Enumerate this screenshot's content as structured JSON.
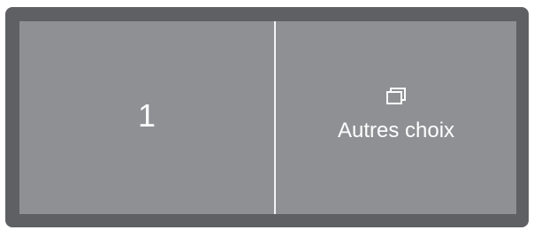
{
  "panel": {
    "left_tile": {
      "value": "1"
    },
    "right_tile": {
      "icon": "windows-stack-icon",
      "label": "Autres choix"
    }
  },
  "colors": {
    "frame": "#5f6064",
    "panel": "#8f9094",
    "divider": "#f4f4f4",
    "text": "#ffffff"
  }
}
